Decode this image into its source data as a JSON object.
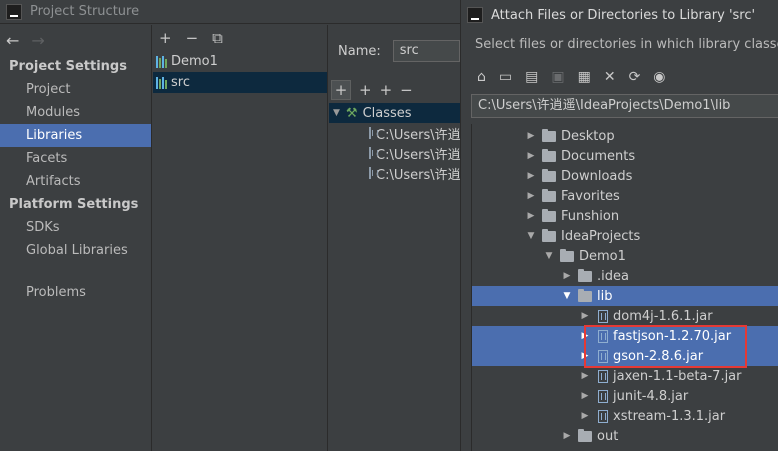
{
  "project_structure": {
    "title": "Project Structure",
    "nav": {
      "back": "←",
      "forward": "→",
      "project_settings_header": "Project Settings",
      "project_settings_items": [
        "Project",
        "Modules",
        "Libraries",
        "Facets",
        "Artifacts"
      ],
      "platform_settings_header": "Platform Settings",
      "platform_settings_items": [
        "SDKs",
        "Global Libraries"
      ],
      "problems": "Problems",
      "selected": "Libraries"
    },
    "libraries_toolbar": {
      "add": "+",
      "remove": "−",
      "copy": "⧉"
    },
    "libraries": [
      "Demo1",
      "src"
    ],
    "detail": {
      "name_label": "Name:",
      "name_value": "src",
      "toolbar": {
        "add": "+",
        "add_special": "+",
        "add_alt": "+",
        "remove": "−"
      },
      "classes_label": "Classes",
      "paths": [
        "C:\\Users\\许逍",
        "C:\\Users\\许逍",
        "C:\\Users\\许逍"
      ]
    }
  },
  "attach_dialog": {
    "title": "Attach Files or Directories to Library 'src'",
    "description": "Select files or directories in which library classes, sou",
    "toolbar": {
      "home": "⌂",
      "desktop": "▭",
      "project": "▤",
      "module": "▣",
      "new_folder": "▦",
      "delete": "✕",
      "refresh": "⟳",
      "hidden": "◉"
    },
    "path": "C:\\Users\\许逍遥\\IdeaProjects\\Demo1\\lib",
    "tree": [
      {
        "label": "Desktop",
        "type": "folder",
        "expanded": false
      },
      {
        "label": "Documents",
        "type": "folder",
        "expanded": false
      },
      {
        "label": "Downloads",
        "type": "folder",
        "expanded": false
      },
      {
        "label": "Favorites",
        "type": "folder",
        "expanded": false
      },
      {
        "label": "Funshion",
        "type": "folder",
        "expanded": false
      },
      {
        "label": "IdeaProjects",
        "type": "folder",
        "expanded": true
      },
      {
        "label": "Demo1",
        "type": "folder",
        "expanded": true
      },
      {
        "label": ".idea",
        "type": "folder",
        "expanded": false
      },
      {
        "label": "lib",
        "type": "folder",
        "expanded": true,
        "selected": true
      },
      {
        "label": "dom4j-1.6.1.jar",
        "type": "jar"
      },
      {
        "label": "fastjson-1.2.70.jar",
        "type": "jar",
        "selected": true
      },
      {
        "label": "gson-2.8.6.jar",
        "type": "jar",
        "selected": true
      },
      {
        "label": "jaxen-1.1-beta-7.jar",
        "type": "jar"
      },
      {
        "label": "junit-4.8.jar",
        "type": "jar"
      },
      {
        "label": "xstream-1.3.1.jar",
        "type": "jar"
      },
      {
        "label": "out",
        "type": "folder",
        "expanded": false
      }
    ]
  },
  "colors": {
    "background": "#3c3f41",
    "selection": "#4b6eaf",
    "inactive_selection": "#0d293e",
    "highlight_box": "#e53935"
  }
}
